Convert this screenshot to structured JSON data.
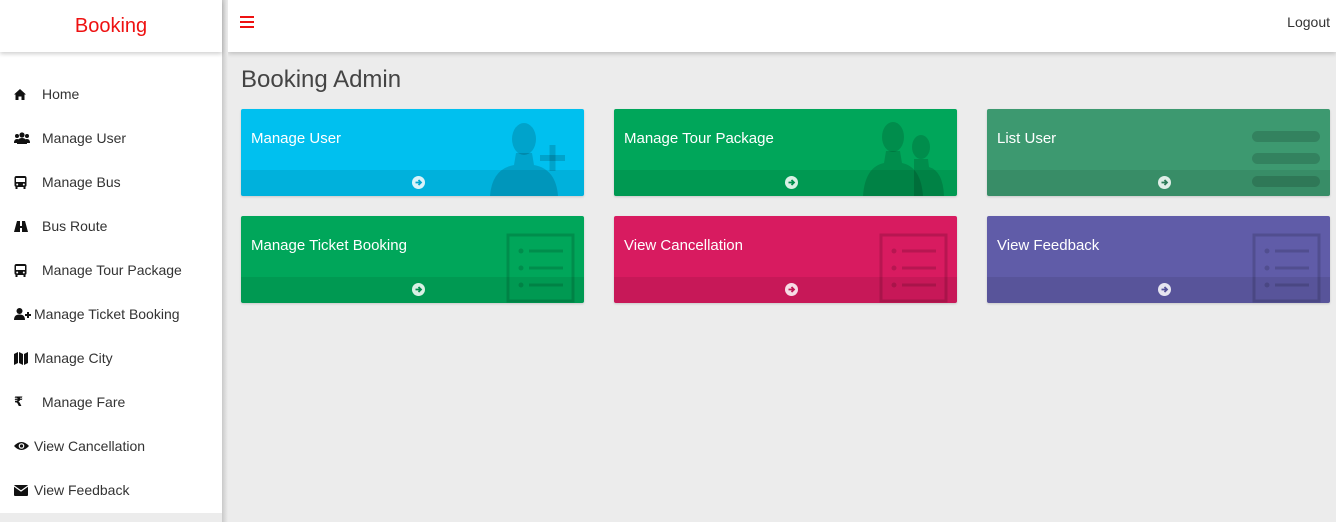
{
  "brand": {
    "title": "Booking",
    "color": "#ee1111"
  },
  "topbar": {
    "menu_icon": "hamburger-icon",
    "logout_label": "Logout"
  },
  "sidebar": {
    "items": [
      {
        "label": "Home",
        "icon": "home-icon"
      },
      {
        "label": "Manage User",
        "icon": "users-icon"
      },
      {
        "label": "Manage Bus",
        "icon": "bus-icon"
      },
      {
        "label": "Bus Route",
        "icon": "road-icon"
      },
      {
        "label": "Manage Tour Package",
        "icon": "bus-icon"
      },
      {
        "label": "Manage Ticket Booking",
        "icon": "user-plus-icon"
      },
      {
        "label": "Manage City",
        "icon": "map-icon"
      },
      {
        "label": "Manage Fare",
        "icon": "rupee-icon"
      },
      {
        "label": "View Cancellation",
        "icon": "eye-icon"
      },
      {
        "label": "View Feedback",
        "icon": "envelope-icon"
      }
    ]
  },
  "main": {
    "page_title": "Booking Admin",
    "tiles": [
      {
        "title": "Manage User",
        "color": "#00c0ef",
        "icon": "user-plus-icon"
      },
      {
        "title": "Manage Tour Package",
        "color": "#00a65a",
        "icon": "users-icon"
      },
      {
        "title": "List User",
        "color": "#3d9970",
        "icon": "list-bars-icon"
      },
      {
        "title": "Manage Ticket Booking",
        "color": "#00a65a",
        "icon": "list-icon"
      },
      {
        "title": "View Cancellation",
        "color": "#d81b60",
        "icon": "list-icon"
      },
      {
        "title": "View Feedback",
        "color": "#605ca8",
        "icon": "list-icon"
      }
    ],
    "tile_link_icon": "arrow-circle-right-icon"
  }
}
